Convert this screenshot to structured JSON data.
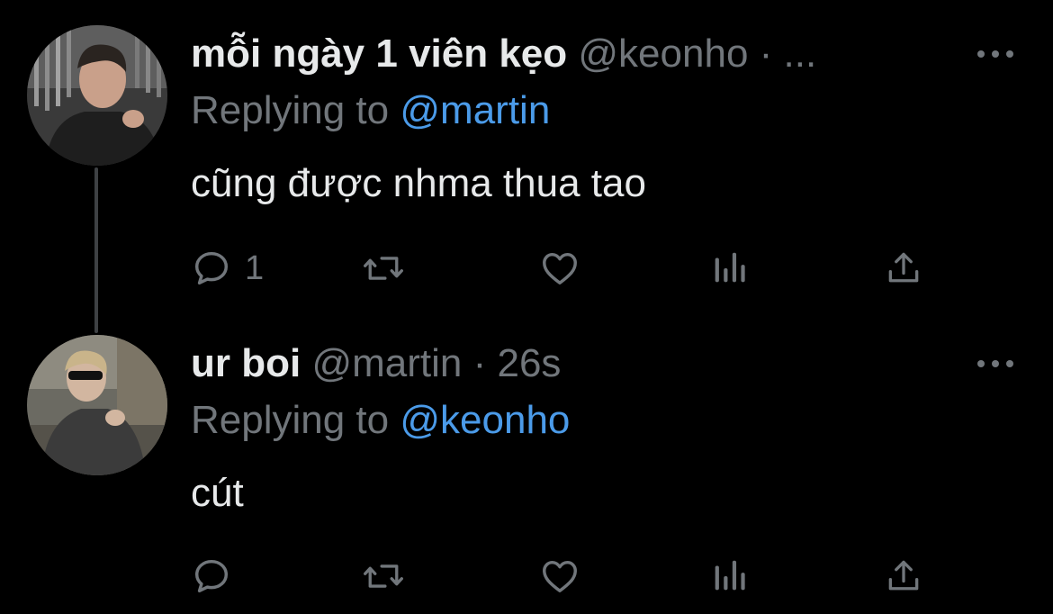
{
  "colors": {
    "background": "#000000",
    "text_primary": "#e7e9ea",
    "text_secondary": "#71767b",
    "accent_link": "#4b9be9",
    "thread_line": "#3e4144"
  },
  "tweets": [
    {
      "display_name": "mỗi ngày 1 viên kẹo",
      "handle": "@keonho",
      "separator": "·",
      "time": "...",
      "replying_prefix": "Replying to",
      "replying_to": "@martin",
      "text": "cũng được nhma thua tao",
      "reply_count": "1",
      "icons": {
        "more": "more-horizontal-icon",
        "reply": "comment-bubble-icon",
        "retweet": "retweet-arrows-icon",
        "like": "heart-icon",
        "views": "bar-chart-icon",
        "share": "share-upload-icon"
      }
    },
    {
      "display_name": "ur boi",
      "handle": "@martin",
      "separator": "·",
      "time": "26s",
      "replying_prefix": "Replying to",
      "replying_to": "@keonho",
      "text": "cút",
      "reply_count": "",
      "icons": {
        "more": "more-horizontal-icon",
        "reply": "comment-bubble-icon",
        "retweet": "retweet-arrows-icon",
        "like": "heart-icon",
        "views": "bar-chart-icon",
        "share": "share-upload-icon"
      }
    }
  ]
}
